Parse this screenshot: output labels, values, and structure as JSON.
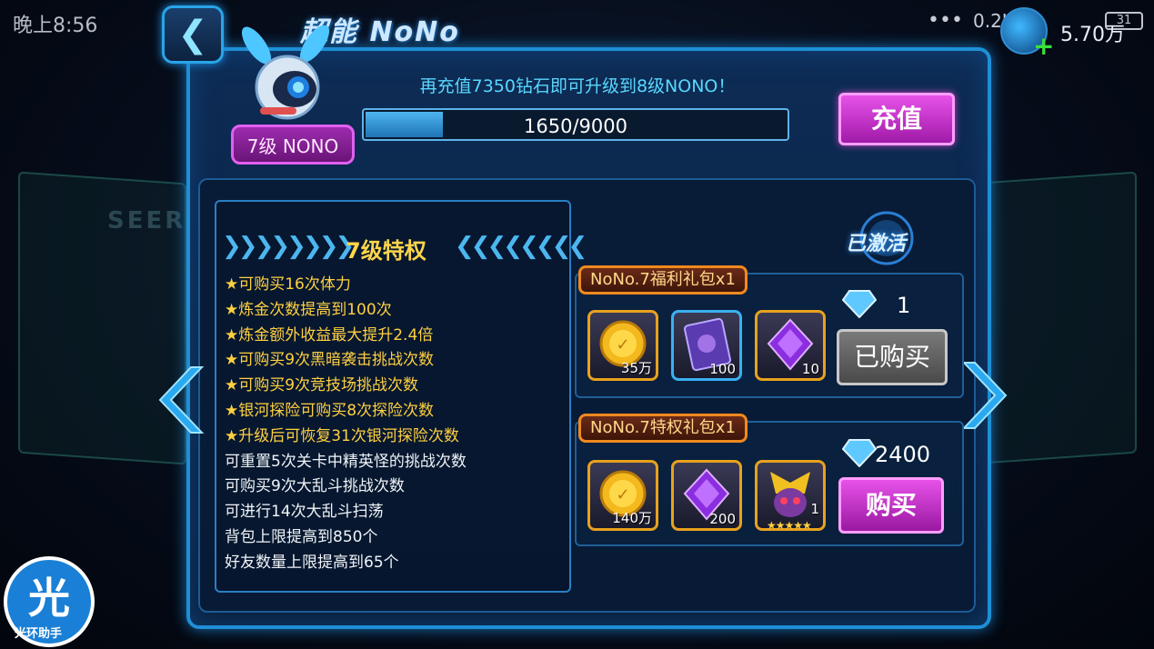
{
  "status_bar": {
    "time": "晚上8:56",
    "dots": "•••",
    "speed": "0.2K/s",
    "battery": "31"
  },
  "header": {
    "title": "超能 NoNo",
    "back_icon": "back-arrow-icon",
    "currency_value": "5.70万"
  },
  "background_text": "SEER",
  "level": {
    "badge": "7级 NONO",
    "upgrade_message": "再充值7350钻石即可升级到8级NONO！",
    "progress_text": "1650/9000",
    "progress_fraction": 0.1833,
    "recharge_label": "充值"
  },
  "privileges": {
    "title": "7级特权",
    "items": [
      {
        "text": "★可购买16次体力",
        "style": "gold"
      },
      {
        "text": "★炼金次数提高到100次",
        "style": "gold"
      },
      {
        "text": "★炼金额外收益最大提升2.4倍",
        "style": "gold"
      },
      {
        "text": "★可购买9次黑暗袭击挑战次数",
        "style": "gold"
      },
      {
        "text": "★可购买9次竞技场挑战次数",
        "style": "gold"
      },
      {
        "text": "★银河探险可购买8次探险次数",
        "style": "gold"
      },
      {
        "text": "★升级后可恢复31次银河探险次数",
        "style": "gold"
      },
      {
        "text": "可重置5次关卡中精英怪的挑战次数",
        "style": "white"
      },
      {
        "text": "可购买9次大乱斗挑战次数",
        "style": "white"
      },
      {
        "text": "可进行14次大乱斗扫荡",
        "style": "white"
      },
      {
        "text": "背包上限提高到850个",
        "style": "white"
      },
      {
        "text": "好友数量上限提高到65个",
        "style": "white"
      }
    ]
  },
  "activated_label": "已激活",
  "packages": [
    {
      "name": "NoNo.7福利礼包x1",
      "price": "1",
      "button": "已购买",
      "items": [
        {
          "icon": "gold-coin-icon",
          "count": "35万"
        },
        {
          "icon": "purple-card-icon",
          "count": "100"
        },
        {
          "icon": "purple-crystal-icon",
          "count": "10"
        }
      ]
    },
    {
      "name": "NoNo.7特权礼包x1",
      "price": "2400",
      "button": "购买",
      "items": [
        {
          "icon": "gold-coin-icon",
          "count": "140万"
        },
        {
          "icon": "purple-crystal-icon",
          "count": "200"
        },
        {
          "icon": "monster-portrait-icon",
          "count": "1",
          "stars": "★★★★★"
        }
      ]
    }
  ],
  "halo_logo": {
    "glyph": "光",
    "text": "光环助手"
  },
  "colors": {
    "frame_blue": "#1e8fd6",
    "gold_text": "#ffd040",
    "purple_button": "#e752e8",
    "cyan_message": "#59d7ff"
  }
}
